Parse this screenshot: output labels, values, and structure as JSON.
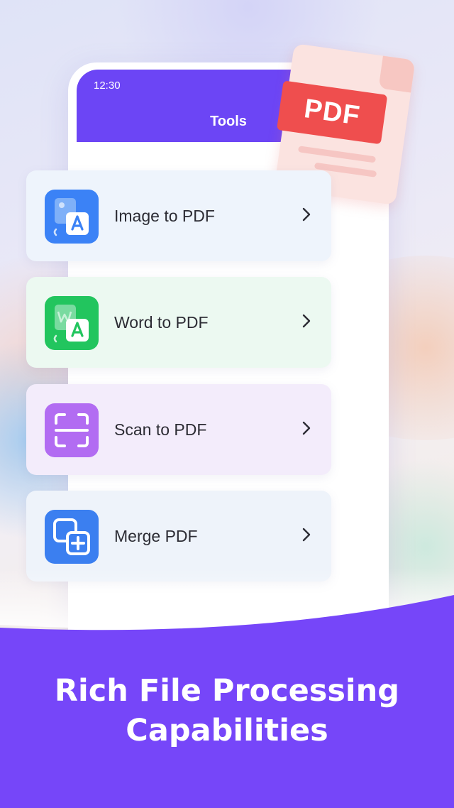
{
  "phone": {
    "status_time": "12:30",
    "title": "Tools"
  },
  "tools": [
    {
      "label": "Image to PDF",
      "icon": "image-to-pdf-icon",
      "icon_color": "#3b82f6",
      "card_color": "#eef4fc"
    },
    {
      "label": "Word to PDF",
      "icon": "word-to-pdf-icon",
      "icon_color": "#22c55e",
      "card_color": "#ecf9f1"
    },
    {
      "label": "Scan to PDF",
      "icon": "scan-icon",
      "icon_color": "#b26cf2",
      "card_color": "#f3ecfb"
    },
    {
      "label": "Merge PDF",
      "icon": "merge-icon",
      "icon_color": "#3b7ff0",
      "card_color": "#eef3fa"
    }
  ],
  "pdf_badge": {
    "text": "PDF",
    "color": "#ef4e4e"
  },
  "headline": {
    "line1": "Rich File Processing",
    "line2": "Capabilities"
  },
  "colors": {
    "accent": "#6c45f5",
    "banner": "#7646f9"
  }
}
